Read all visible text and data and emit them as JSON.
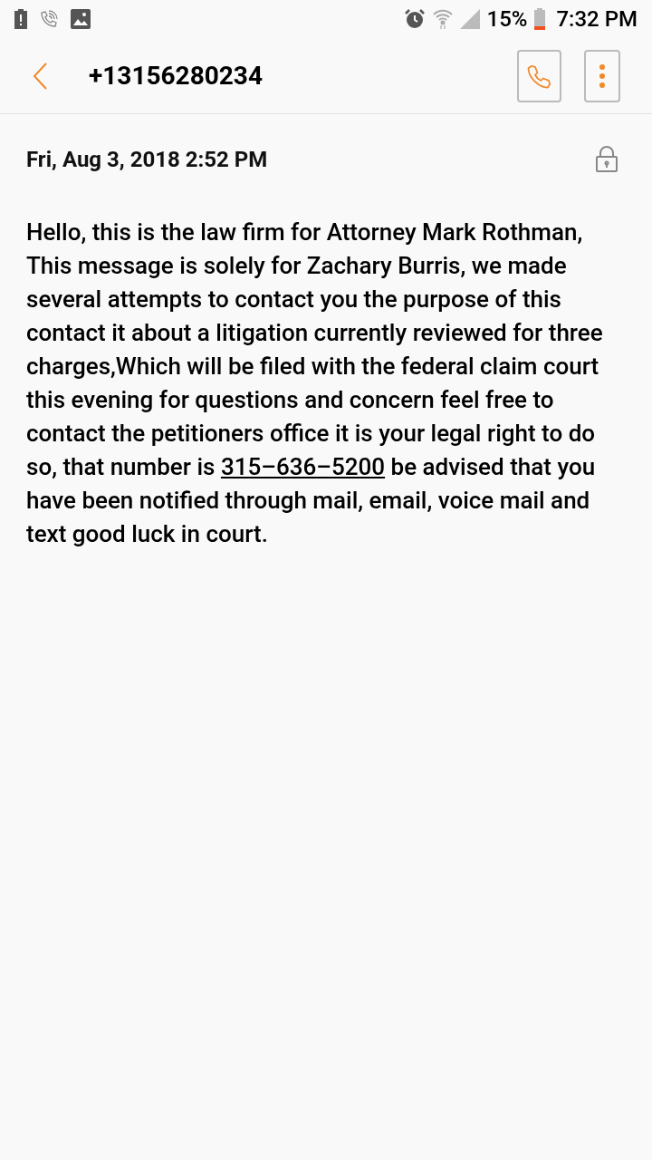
{
  "status_bar": {
    "battery": "15%",
    "time": "7:32 PM"
  },
  "header": {
    "title": "+13156280234"
  },
  "message": {
    "date": "Fri, Aug 3, 2018 2:52 PM",
    "text_before": "Hello, this is the law firm for Attorney Mark Rothman, This message is solely for  Zachary Burris, we made several attempts to contact you the purpose of this contact it about a litigation currently reviewed for three charges,Which will be filed with the federal claim court this evening for questions and concern feel free to contact the petitioners office it is your legal right to do so, that number is",
    "link": "315–636–5200",
    "text_after": "be advised that you have been notified through mail, email, voice mail and text good luck in court."
  }
}
